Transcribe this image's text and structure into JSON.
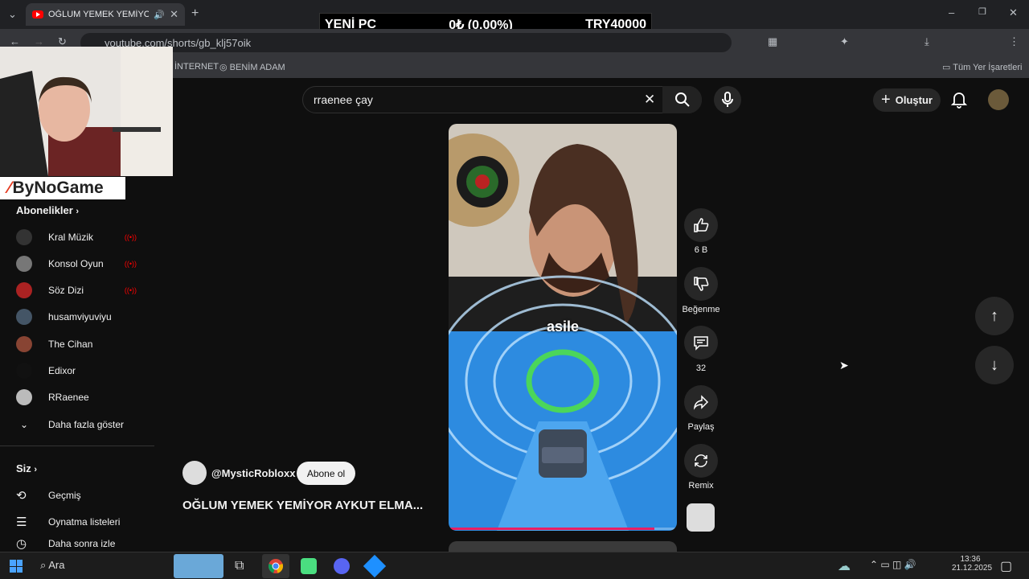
{
  "browser": {
    "tab_title": "OĞLUM YEMEK YEMİYOR A",
    "url": "youtube.com/shorts/gb_klj57oik",
    "bookmarks": [
      "İNTERNET",
      "BENİM ADAM"
    ],
    "all_bookmarks": "Tüm Yer İşaretleri"
  },
  "ticker": {
    "name": "YENİ PC",
    "progress": "0₺ (0.00%)",
    "goal": "TRY40000"
  },
  "overlay": {
    "sponsor": "ByNoGame"
  },
  "youtube": {
    "search_value": "rraenee çay",
    "create_label": "Oluştur",
    "sidebar": {
      "subscriptions_title": "Abonelikler",
      "channels": [
        {
          "name": "Kral Müzik",
          "live": true,
          "color": "#333333"
        },
        {
          "name": "Konsol Oyun",
          "live": true,
          "color": "#777777"
        },
        {
          "name": "Söz Dizi",
          "live": true,
          "color": "#aa2222"
        },
        {
          "name": "husamviyuviyu",
          "live": false,
          "color": "#445566"
        },
        {
          "name": "The Cihan",
          "live": false,
          "color": "#884433"
        },
        {
          "name": "Edixor",
          "live": false,
          "color": "#111111"
        },
        {
          "name": "RRaenee",
          "live": false,
          "color": "#bbbbbb"
        }
      ],
      "show_more": "Daha fazla göster",
      "you_title": "Siz",
      "you_items": [
        "Geçmiş",
        "Oynatma listeleri",
        "Daha sonra izle"
      ]
    },
    "short": {
      "channel": "@MysticRobloxx",
      "subscribe": "Abone ol",
      "title": "OĞLUM YEMEK YEMİYOR AYKUT ELMA...",
      "caption": "asile",
      "progress": 0.9
    },
    "actions": [
      {
        "icon": "like-icon",
        "label": "6 B"
      },
      {
        "icon": "dislike-icon",
        "label": "Beğenme"
      },
      {
        "icon": "comment-icon",
        "label": "32"
      },
      {
        "icon": "share-icon",
        "label": "Paylaş"
      },
      {
        "icon": "remix-icon",
        "label": "Remix"
      }
    ]
  },
  "taskbar": {
    "search": "Ara",
    "time": "13:36",
    "date": "21.12.2025"
  },
  "colors": {
    "yt_red": "#ff0000",
    "progress": "#e91e63",
    "bg": "#0f0f0f"
  }
}
